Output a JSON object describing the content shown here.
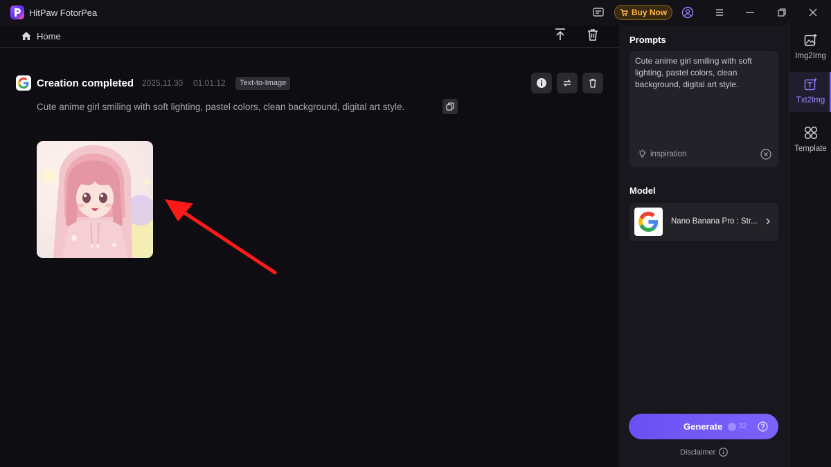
{
  "window": {
    "title": "HitPaw FotorPea",
    "buy_label": "Buy Now"
  },
  "nav": {
    "home_label": "Home"
  },
  "creation": {
    "status": "Creation completed",
    "date": "2025.11.30",
    "time": "01:01:12",
    "tag": "Text-to-Image",
    "prompt": "Cute anime girl smiling with soft lighting, pastel colors, clean background, digital art style."
  },
  "panel": {
    "prompts_heading": "Prompts",
    "prompt_value": "Cute anime girl smiling with soft lighting, pastel colors, clean background, digital art style.",
    "inspiration_label": "inspiration",
    "model_heading": "Model",
    "model_name": "Nano Banana Pro : Str...",
    "generate_label": "Generate",
    "generate_cost": "32",
    "disclaimer_label": "Disclaimer"
  },
  "side_nav": [
    {
      "label": "Img2Img"
    },
    {
      "label": "Txt2Img"
    },
    {
      "label": "Template"
    }
  ],
  "colors": {
    "accent": "#7b63ff",
    "buy": "#ffb84a",
    "background": "#0e0d12",
    "arrow": "#ff1a1a"
  }
}
